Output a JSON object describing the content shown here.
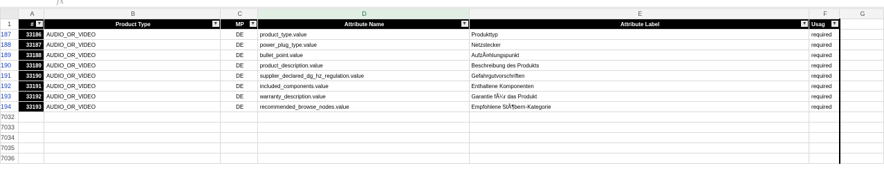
{
  "formula_bar": {
    "fx": "fx"
  },
  "columns": [
    "A",
    "B",
    "C",
    "D",
    "E",
    "F",
    "G"
  ],
  "header_row": {
    "row_label": "1",
    "num": "#",
    "product_type": "Product Type",
    "mp": "MP",
    "attribute_name": "Attribute Name",
    "attribute_label": "Attribute Label",
    "usage": "Usag"
  },
  "rows": [
    {
      "r": "187",
      "num": "33186",
      "pt": "AUDIO_OR_VIDEO",
      "mp": "DE",
      "name": "product_type.value",
      "label": "Produkttyp",
      "usage": "required"
    },
    {
      "r": "188",
      "num": "33187",
      "pt": "AUDIO_OR_VIDEO",
      "mp": "DE",
      "name": "power_plug_type.value",
      "label": "Netzstecker",
      "usage": "required"
    },
    {
      "r": "189",
      "num": "33188",
      "pt": "AUDIO_OR_VIDEO",
      "mp": "DE",
      "name": "bullet_point.value",
      "label": "AufzÃ¤hlungspunkt",
      "usage": "required"
    },
    {
      "r": "190",
      "num": "33189",
      "pt": "AUDIO_OR_VIDEO",
      "mp": "DE",
      "name": "product_description.value",
      "label": "Beschreibung des Produkts",
      "usage": "required"
    },
    {
      "r": "191",
      "num": "33190",
      "pt": "AUDIO_OR_VIDEO",
      "mp": "DE",
      "name": "supplier_declared_dg_hz_regulation.value",
      "label": "Gefahrgutvorschriften",
      "usage": "required"
    },
    {
      "r": "192",
      "num": "33191",
      "pt": "AUDIO_OR_VIDEO",
      "mp": "DE",
      "name": "included_components.value",
      "label": "Enthaltene Komponenten",
      "usage": "required"
    },
    {
      "r": "193",
      "num": "33192",
      "pt": "AUDIO_OR_VIDEO",
      "mp": "DE",
      "name": "warranty_description.value",
      "label": "Garantie fÃ¼r das Produkt",
      "usage": "required"
    },
    {
      "r": "194",
      "num": "33193",
      "pt": "AUDIO_OR_VIDEO",
      "mp": "DE",
      "name": "recommended_browse_nodes.value",
      "label": "Empfohlene StÃ¶bern-Kategorie",
      "usage": "required"
    }
  ],
  "empty_rows": [
    "7032",
    "7033",
    "7034",
    "7035",
    "7036"
  ]
}
